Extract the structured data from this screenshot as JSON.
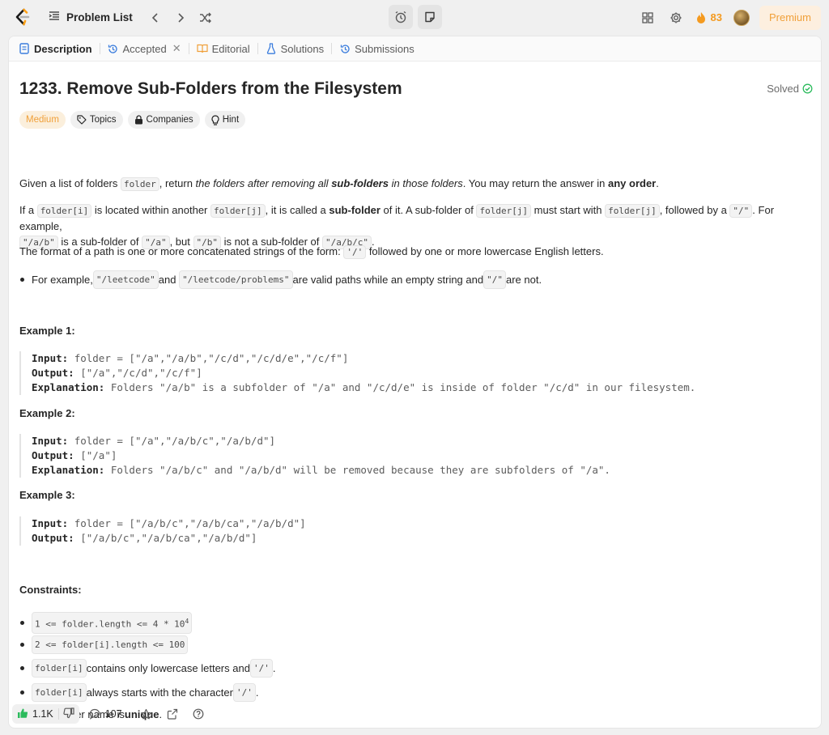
{
  "topbar": {
    "problem_list_label": "Problem List",
    "streak_count": "83",
    "premium_label": "Premium"
  },
  "tabs": [
    {
      "label": "Description"
    },
    {
      "label": "Accepted"
    },
    {
      "label": "Editorial"
    },
    {
      "label": "Solutions"
    },
    {
      "label": "Submissions"
    }
  ],
  "problem": {
    "title": "1233. Remove Sub-Folders from the Filesystem",
    "status": "Solved",
    "difficulty": "Medium",
    "tags": [
      "Topics",
      "Companies",
      "Hint"
    ]
  },
  "description": {
    "p1": {
      "t1": "Given a list of folders ",
      "c1": "folder",
      "t2": ", return ",
      "i1": "the folders after removing all ",
      "b1": "sub-folders",
      "i2": " in those folders",
      "t3": ". You may return the answer in ",
      "b2": "any order",
      "t4": "."
    },
    "p2": {
      "t1": "If a ",
      "c1": "folder[i]",
      "t2": " is located within another ",
      "c2": "folder[j]",
      "t3": ", it is called a ",
      "b1": "sub-folder",
      "t4": " of it. A sub-folder of ",
      "c3": "folder[j]",
      "t5": " must start with ",
      "c4": "folder[j]",
      "t6": ", followed by a ",
      "c5": "\"/\"",
      "t7": ". For example, ",
      "c6": "\"/a/b\"",
      "t8": " is a sub-folder of ",
      "c7": "\"/a\"",
      "t9": ", but ",
      "c8": "\"/b\"",
      "t10": " is not a sub-folder of ",
      "c9": "\"/a/b/c\"",
      "t11": "."
    },
    "p3": {
      "t1": "The format of a path is one or more concatenated strings of the form: ",
      "c1": "'/'",
      "t2": " followed by one or more lowercase English letters."
    },
    "bullet": {
      "t1": "For example, ",
      "c1": "\"/leetcode\"",
      "t2": " and ",
      "c2": "\"/leetcode/problems\"",
      "t3": " are valid paths while an empty string and ",
      "c3": "\"/\"",
      "t4": " are not."
    }
  },
  "examples": [
    {
      "heading": "Example 1:",
      "input_label": "Input:",
      "input": "folder = [\"/a\",\"/a/b\",\"/c/d\",\"/c/d/e\",\"/c/f\"]",
      "output_label": "Output:",
      "output": "[\"/a\",\"/c/d\",\"/c/f\"]",
      "explanation_label": "Explanation:",
      "explanation": "Folders \"/a/b\" is a subfolder of \"/a\" and \"/c/d/e\" is inside of folder \"/c/d\" in our filesystem."
    },
    {
      "heading": "Example 2:",
      "input_label": "Input:",
      "input": "folder = [\"/a\",\"/a/b/c\",\"/a/b/d\"]",
      "output_label": "Output:",
      "output": "[\"/a\"]",
      "explanation_label": "Explanation:",
      "explanation": "Folders \"/a/b/c\" and \"/a/b/d\" will be removed because they are subfolders of \"/a\"."
    },
    {
      "heading": "Example 3:",
      "input_label": "Input:",
      "input": "folder = [\"/a/b/c\",\"/a/b/ca\",\"/a/b/d\"]",
      "output_label": "Output:",
      "output": "[\"/a/b/c\",\"/a/b/ca\",\"/a/b/d\"]"
    }
  ],
  "constraints": {
    "heading": "Constraints:",
    "c1": {
      "code": "1 <= folder.length <= 4 * 10",
      "sup": "4"
    },
    "c2": {
      "code": "2 <= folder[i].length <= 100"
    },
    "c3": {
      "c1": "folder[i]",
      "t1": " contains only lowercase letters and ",
      "c2": "'/'",
      "t2": "."
    },
    "c4": {
      "c1": "folder[i]",
      "t1": " always starts with the character ",
      "c2": "'/'",
      "t2": "."
    },
    "c5": {
      "t1": "Each folder name is ",
      "b1": "unique",
      "t2": "."
    }
  },
  "footer": {
    "likes": "1.1K",
    "comments": "107"
  },
  "colors": {
    "accent_orange": "#f0a03a",
    "solved_green": "#2cbb5d",
    "like_green": "#2cbb5d"
  }
}
